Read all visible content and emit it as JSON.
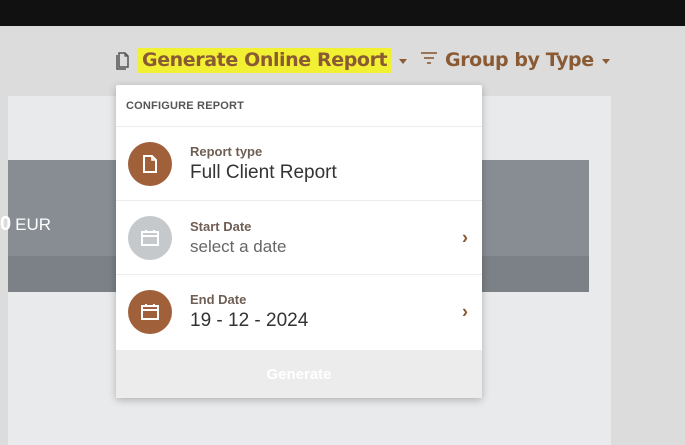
{
  "toolbar": {
    "generate_label": "Generate Online Report",
    "group_by_label": "Group by Type"
  },
  "card": {
    "amount_fragment": "0",
    "currency": "EUR"
  },
  "dropdown": {
    "header": "CONFIGURE REPORT",
    "items": [
      {
        "label": "Report type",
        "value": "Full Client Report",
        "icon": "document-icon",
        "state": "set"
      },
      {
        "label": "Start Date",
        "value": "select a date",
        "icon": "calendar-icon",
        "state": "unset"
      },
      {
        "label": "End Date",
        "value": "19 - 12 - 2024",
        "icon": "calendar-icon",
        "state": "set"
      }
    ],
    "footer_button": "Generate"
  },
  "colors": {
    "accent_brown": "#a0613a",
    "highlight_yellow": "#f2f032",
    "disabled_grey": "#c6c9cc"
  }
}
